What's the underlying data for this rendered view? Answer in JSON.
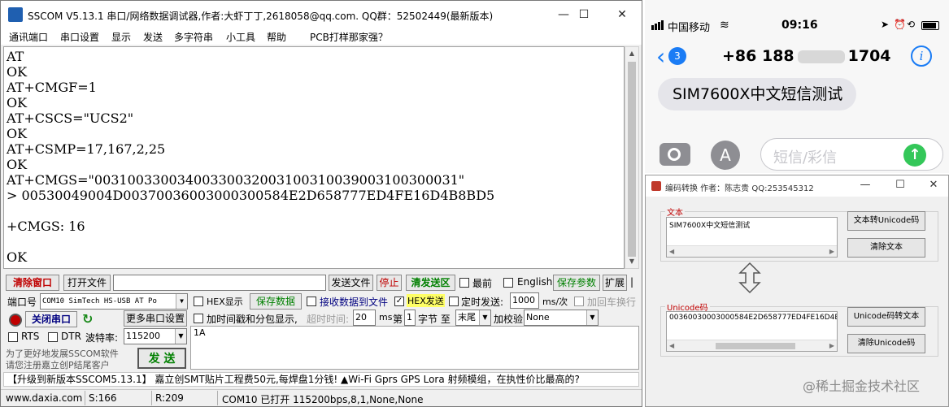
{
  "sscom": {
    "title": "SSCOM V5.13.1 串口/网络数据调试器,作者:大虾丁丁,2618058@qq.com. QQ群：52502449(最新版本)",
    "window_buttons": [
      "—",
      "☐",
      "✕"
    ],
    "menu": [
      "通讯端口",
      "串口设置",
      "显示",
      "发送",
      "多字符串",
      "小工具",
      "帮助",
      "PCB打样那家强？"
    ],
    "terminal_lines": [
      "AT",
      "OK",
      "AT+CMGF=1",
      "OK",
      "AT+CSCS=\"UCS2\"",
      "OK",
      "AT+CSMP=17,167,2,25",
      "OK",
      "AT+CMGS=\"00310033003400330032003100310039003100300031\"",
      "> 00530049004D00370036003000300584E2D658777ED4FE16D4B8BD5",
      "",
      "+CMGS: 16",
      "",
      "OK"
    ],
    "row1": {
      "clear_window": "清除窗口",
      "open_file": "打开文件",
      "send_file": "发送文件",
      "stop": "停止",
      "clear_send": "清发送区",
      "front": "最前",
      "english": "English",
      "save_params": "保存参数",
      "expand": "扩展"
    },
    "port_label": "端口号",
    "port_value": "COM10 SimTech HS-USB AT Po",
    "hex_display": "HEX显示",
    "save_data": "保存数据",
    "recv_to_file": "接收数据到文件",
    "hex_send": "HEX发送",
    "timed_send": "定时发送:",
    "timed_value": "1000",
    "timed_unit": "ms/次",
    "add_newline": "加回车换行",
    "close_port": "关闭串口",
    "more_settings": "更多串口设置",
    "timestamp_label": "加时间戳和分包显示,",
    "timeout_label": "超时时间:",
    "timeout_value": "20",
    "ms_label": "ms",
    "di_label": "第",
    "byte_value": "1",
    "byte_label": "字节 至",
    "end_value": "末尾",
    "checksum_label": "加校验",
    "checksum_value": "None",
    "rts": "RTS",
    "dtr": "DTR",
    "baud_label": "波特率:",
    "baud_value": "115200",
    "send_content": "1A",
    "promo_line1": "为了更好地发展SSCOM软件",
    "promo_line2": "请您注册嘉立创P结尾客户",
    "send_button": "发 送",
    "ad_text": "【升级到新版本SSCOM5.13.1】      嘉立创SMT贴片工程费50元,每焊盘1分钱! ▲Wi-Fi Gprs GPS Lora 射频模组，在执性价比最高的?",
    "status": {
      "website": "www.daxia.com",
      "sent": "S:166",
      "received": "R:209",
      "port_status": "COM10 已打开  115200bps,8,1,None,None"
    }
  },
  "phone": {
    "carrier": "中国移动",
    "time": "09:16",
    "back_badge": "3",
    "contact_prefix": "+86 188",
    "contact_suffix": "1704",
    "info_icon_glyph": "i",
    "message": "SIM7600X中文短信测试",
    "input_placeholder": "短信/彩信",
    "app_icon_glyph": "A"
  },
  "converter": {
    "title": "编码转换 作者：陈志贵 QQ:253545312",
    "window_buttons": [
      "—",
      "☐",
      "✕"
    ],
    "text_group_label": "文本",
    "text_content": "SIM7600X中文短信测试",
    "to_unicode": "文本转Unicode码",
    "clear_text": "清除文本",
    "unicode_group_label": "Unicode码",
    "unicode_content": "00360030003000584E2D658777ED4FE16D4B8BD5",
    "to_text": "Unicode码转文本",
    "clear_unicode": "清除Unicode码"
  },
  "watermark": "@稀土掘金技术社区",
  "colors": {
    "ios_blue": "#1a7cf5",
    "ios_green": "#34c759",
    "sscom_red_label": "#c00000",
    "save_green": "#008000"
  }
}
